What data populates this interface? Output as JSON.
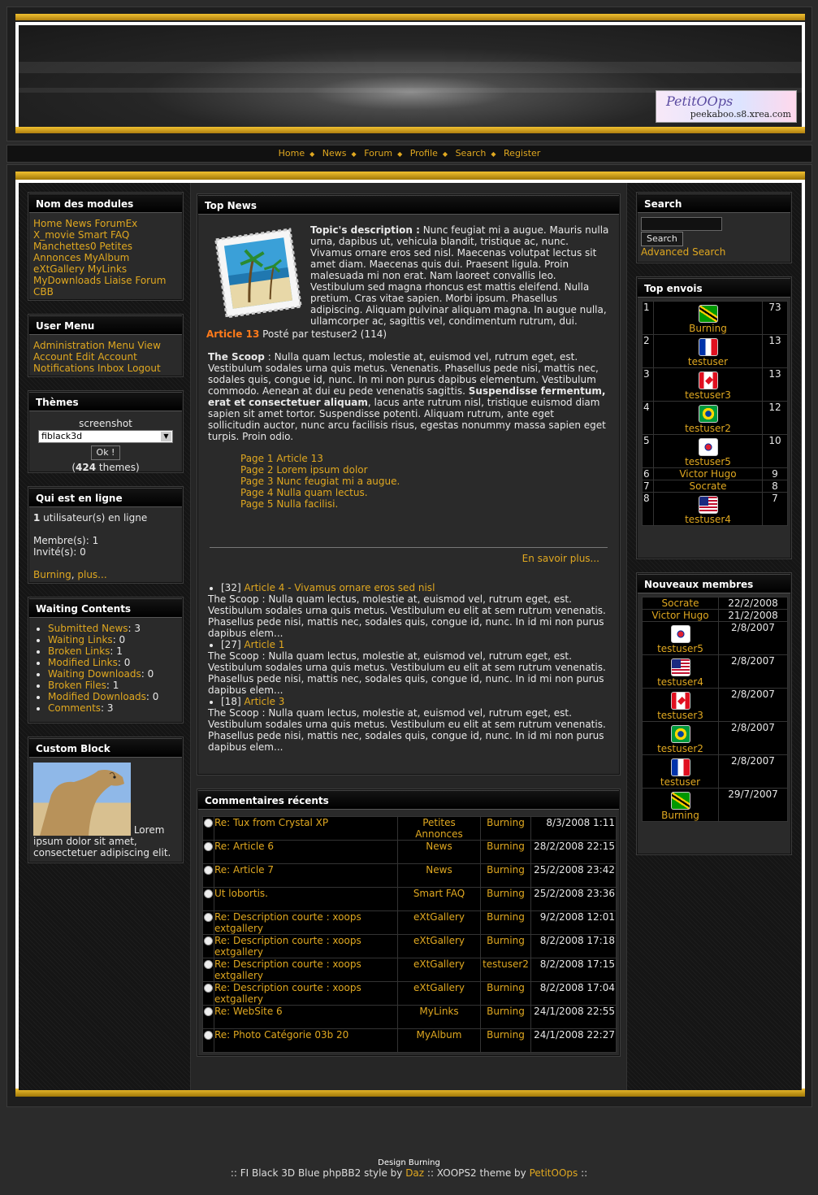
{
  "header": {
    "logo_line1": "PetitOOps",
    "logo_line2": "peekaboo.s8.xrea.com"
  },
  "nav": [
    "Home",
    "News",
    "Forum",
    "Profile",
    "Search",
    "Register"
  ],
  "modules": {
    "title": "Nom des modules",
    "links": [
      "Home",
      "News",
      "ForumEx",
      "X_movie",
      "Smart FAQ",
      "Manchettes0",
      "Petites Annonces",
      "MyAlbum",
      "eXtGallery",
      "MyLinks",
      "MyDownloads",
      "Liaise",
      "Forum CBB"
    ]
  },
  "user_menu": {
    "title": "User Menu",
    "links": [
      "Administration Menu",
      "View Account",
      "Edit Account",
      "Notifications",
      "Inbox",
      "Logout"
    ]
  },
  "themes": {
    "title": "Thèmes",
    "screenshot": "screenshot",
    "selected": "fiblack3d",
    "ok": "Ok !",
    "count": "424",
    "count_suffix": " themes)",
    "count_prefix": "("
  },
  "online": {
    "title": "Qui est en ligne",
    "count": "1",
    "count_text": " utilisateur(s) en ligne",
    "members": "Membre(s): 1",
    "guests": "Invité(s): 0",
    "user": "Burning",
    "more": "plus..."
  },
  "waiting": {
    "title": "Waiting Contents",
    "items": [
      {
        "label": "Submitted News",
        "value": ": 3"
      },
      {
        "label": "Waiting Links",
        "value": ": 0"
      },
      {
        "label": "Broken Links",
        "value": ": 1"
      },
      {
        "label": "Modified Links",
        "value": ": 0"
      },
      {
        "label": "Waiting Downloads",
        "value": ": 0"
      },
      {
        "label": "Broken Files",
        "value": ": 1"
      },
      {
        "label": "Modified Downloads",
        "value": ": 0"
      },
      {
        "label": "Comments",
        "value": ": 3"
      }
    ]
  },
  "custom_block": {
    "title": "Custom Block",
    "text": "Lorem ipsum dolor sit amet, consectetuer adipiscing elit."
  },
  "top_news": {
    "title": "Top News",
    "desc_label": "Topic's description :",
    "desc": " Nunc feugiat mi a augue. Mauris nulla urna, dapibus ut, vehicula blandit, tristique ac, nunc. Vivamus ornare eros sed nisl. Maecenas volutpat lectus sit amet diam. Maecenas quis dui. Praesent ligula. Proin malesuada mi non erat. Nam laoreet convallis leo. Vestibulum sed magna rhoncus est mattis eleifend. Nulla pretium. Cras vitae sapien. Morbi ipsum. Phasellus adipiscing. Aliquam pulvinar aliquam magna. In augue nulla, ullamcorper ac, sagittis vel, condimentum rutrum, dui.",
    "article_title": "Article 13",
    "posted": " Posté par testuser2 (114)",
    "scoop_label": "The Scoop",
    "scoop1": " : Nulla quam lectus, molestie at, euismod vel, rutrum eget, est. Vestibulum sodales urna quis metus. Venenatis. Phasellus pede nisi, mattis nec, sodales quis, congue id, nunc. In mi non purus dapibus elementum. Vestibulum commodo. Aenean at dui eu pede venenatis sagittis. ",
    "scoop_bold": "Suspendisse fermentum, erat et consectetuer aliquam",
    "scoop2": ", lacus ante rutrum nisl, tristique euismod diam sapien sit amet tortor. Suspendisse potenti. Aliquam rutrum, ante eget sollicitudin auctor, nunc arcu facilisis risus, egestas nonummy massa sapien eget turpis. Proin odio.",
    "pages": [
      "Page 1 Article 13",
      "Page 2 Lorem ipsum dolor",
      "Page 3 Nunc feugiat mi a augue.",
      "Page 4 Nulla quam lectus.",
      "Page 5 Nulla facilisi."
    ],
    "more": "En savoir plus...",
    "others": [
      {
        "num": "[32] ",
        "title": "Article 4 - Vivamus ornare eros sed nisl",
        "text": "The Scoop : Nulla quam lectus, molestie at, euismod vel, rutrum eget, est. Vestibulum sodales urna quis metus. Vestibulum eu elit at sem rutrum venenatis. Phasellus pede nisi, mattis nec, sodales quis, congue id, nunc. In id mi non purus dapibus elem..."
      },
      {
        "num": "[27] ",
        "title": "Article 1",
        "text": "The Scoop : Nulla quam lectus, molestie at, euismod vel, rutrum eget, est. Vestibulum sodales urna quis metus. Vestibulum eu elit at sem rutrum venenatis. Phasellus pede nisi, mattis nec, sodales quis, congue id, nunc. In id mi non purus dapibus elem..."
      },
      {
        "num": "[18] ",
        "title": "Article 3",
        "text": "The Scoop : Nulla quam lectus, molestie at, euismod vel, rutrum eget, est. Vestibulum sodales urna quis metus. Vestibulum eu elit at sem rutrum venenatis. Phasellus pede nisi, mattis nec, sodales quis, congue id, nunc. In id mi non purus dapibus elem..."
      }
    ]
  },
  "comments": {
    "title": "Commentaires récents",
    "rows": [
      {
        "title": "Re: Tux from Crystal XP",
        "module": "Petites Annonces",
        "user": "Burning",
        "date": "8/3/2008 1:11"
      },
      {
        "title": "Re: Article 6",
        "module": "News",
        "user": "Burning",
        "date": "28/2/2008 22:15"
      },
      {
        "title": "Re: Article 7",
        "module": "News",
        "user": "Burning",
        "date": "25/2/2008 23:42"
      },
      {
        "title": "Ut lobortis.",
        "module": "Smart FAQ",
        "user": "Burning",
        "date": "25/2/2008 23:36"
      },
      {
        "title": "Re: Description courte : xoops extgallery",
        "module": "eXtGallery",
        "user": "Burning",
        "date": "9/2/2008 12:01"
      },
      {
        "title": "Re: Description courte : xoops extgallery",
        "module": "eXtGallery",
        "user": "Burning",
        "date": "8/2/2008 17:18"
      },
      {
        "title": "Re: Description courte : xoops extgallery",
        "module": "eXtGallery",
        "user": "testuser2",
        "date": "8/2/2008 17:15"
      },
      {
        "title": "Re: Description courte : xoops extgallery",
        "module": "eXtGallery",
        "user": "Burning",
        "date": "8/2/2008 17:04"
      },
      {
        "title": "Re: WebSite 6",
        "module": "MyLinks",
        "user": "Burning",
        "date": "24/1/2008 22:55"
      },
      {
        "title": "Re: Photo Catégorie 03b 20",
        "module": "MyAlbum",
        "user": "Burning",
        "date": "24/1/2008 22:27"
      }
    ]
  },
  "search": {
    "title": "Search",
    "button": "Search",
    "advanced": "Advanced Search"
  },
  "top_posters": {
    "title": "Top envois",
    "rows": [
      {
        "rank": "1",
        "name": "Burning",
        "flag": "jm-flag",
        "count": "73"
      },
      {
        "rank": "2",
        "name": "testuser",
        "flag": "fr-flag",
        "count": "13"
      },
      {
        "rank": "3",
        "name": "testuser3",
        "flag": "ca-flag",
        "count": "13"
      },
      {
        "rank": "4",
        "name": "testuser2",
        "flag": "br-flag",
        "count": "12"
      },
      {
        "rank": "5",
        "name": "testuser5",
        "flag": "kr-flag",
        "count": "10"
      },
      {
        "rank": "6",
        "name": "Victor Hugo",
        "flag": "",
        "count": "9"
      },
      {
        "rank": "7",
        "name": "Socrate",
        "flag": "",
        "count": "8"
      },
      {
        "rank": "8",
        "name": "testuser4",
        "flag": "us-flag",
        "count": "7"
      }
    ]
  },
  "new_members": {
    "title": "Nouveaux membres",
    "rows": [
      {
        "name": "Socrate",
        "flag": "",
        "date": "22/2/2008"
      },
      {
        "name": "Victor Hugo",
        "flag": "",
        "date": "21/2/2008"
      },
      {
        "name": "testuser5",
        "flag": "kr-flag",
        "date": "2/8/2007"
      },
      {
        "name": "testuser4",
        "flag": "us-flag",
        "date": "2/8/2007"
      },
      {
        "name": "testuser3",
        "flag": "ca-flag",
        "date": "2/8/2007"
      },
      {
        "name": "testuser2",
        "flag": "br-flag",
        "date": "2/8/2007"
      },
      {
        "name": "testuser",
        "flag": "fr-flag",
        "date": "2/8/2007"
      },
      {
        "name": "Burning",
        "flag": "jm-flag",
        "date": "29/7/2007"
      }
    ]
  },
  "footer": {
    "design": "Design Burning",
    "pre": ":: FI Black 3D Blue phpBB2 style by ",
    "daz": "Daz",
    "mid": " :: XOOPS2 theme by ",
    "petit": "PetitOOps",
    "post": " ::"
  }
}
